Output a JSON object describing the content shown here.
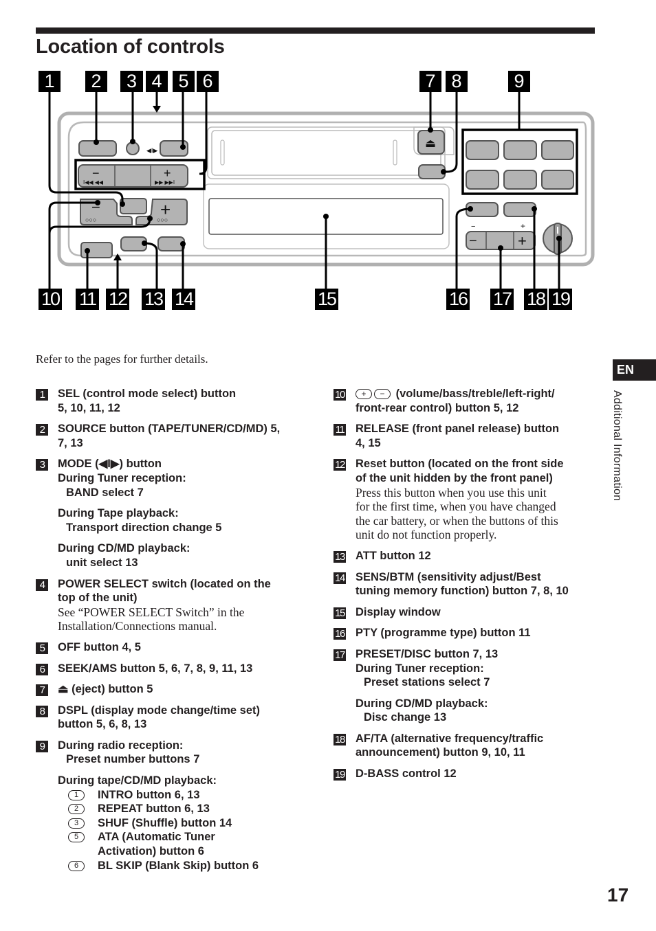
{
  "page": {
    "title": "Location of controls",
    "intro": "Refer to the pages for further details.",
    "section_tab": "EN",
    "side_label": "Additional Information",
    "page_number": "17"
  },
  "diagram": {
    "callouts": [
      "1",
      "2",
      "3",
      "4",
      "5",
      "6",
      "7",
      "8",
      "9",
      "10",
      "11",
      "12",
      "13",
      "14",
      "15",
      "16",
      "17",
      "18",
      "19"
    ],
    "mode_symbol": "◀I▶",
    "minus": "−",
    "plus": "+",
    "seek_back": "I◀◀ ◀◀",
    "seek_fwd": "▶▶ ▶▶I",
    "dots": "○○○",
    "eject": "⏏"
  },
  "left_items": [
    {
      "n": "1",
      "title": "SEL (control mode select) button",
      "line2": "5, 10, 11, 12"
    },
    {
      "n": "2",
      "title": "SOURCE button (TAPE/TUNER/CD/MD) 5,",
      "line2": "7, 13"
    },
    {
      "n": "3",
      "title": "MODE (◀I▶) button",
      "groups": [
        {
          "head": "During Tuner reception:",
          "detail": "BAND select 7"
        },
        {
          "head": "During Tape playback:",
          "detail": "Transport direction change 5"
        },
        {
          "head": "During CD/MD playback:",
          "detail": "unit select 13"
        }
      ]
    },
    {
      "n": "4",
      "title": "POWER SELECT switch (located on the",
      "line2": "top of the unit)",
      "note1": "See “POWER SELECT Switch” in the",
      "note2": "Installation/Connections manual."
    },
    {
      "n": "5",
      "title": "OFF button 4, 5"
    },
    {
      "n": "6",
      "title": "SEEK/AMS button 5, 6, 7, 8, 9, 11, 13"
    },
    {
      "n": "7",
      "title": "⏏ (eject) button 5"
    },
    {
      "n": "8",
      "title": "DSPL (display mode change/time set)",
      "line2": "button 5, 6, 8, 13"
    },
    {
      "n": "9",
      "title": "During radio reception:",
      "detail": "Preset number buttons 7",
      "head2": "During tape/CD/MD playback:",
      "subs": [
        {
          "c": "1",
          "text": "INTRO button 6, 13"
        },
        {
          "c": "2",
          "text": "REPEAT button 6, 13"
        },
        {
          "c": "3",
          "text": "SHUF (Shuffle) button 14"
        },
        {
          "c": "5",
          "text": "ATA (Automatic Tuner",
          "text2": "Activation) button 6"
        },
        {
          "c": "6",
          "text": "BL SKIP (Blank Skip) button 6"
        }
      ]
    }
  ],
  "right_items": [
    {
      "n": "10",
      "plus": "+",
      "minus": "−",
      "title": "(volume/bass/treble/left-right/",
      "line2": "front-rear control) button 5, 12"
    },
    {
      "n": "11",
      "title": "RELEASE (front panel release) button",
      "line2": "4, 15"
    },
    {
      "n": "12",
      "title": "Reset button (located on the front side",
      "line2": "of the unit hidden by the front panel)",
      "note": [
        "Press this button when you use this unit",
        "for the first time, when you have changed",
        "the car battery, or when the buttons of this",
        "unit do not function properly."
      ]
    },
    {
      "n": "13",
      "title": "ATT button 12"
    },
    {
      "n": "14",
      "title": "SENS/BTM (sensitivity adjust/Best",
      "line2": "tuning memory function) button 7, 8, 10"
    },
    {
      "n": "15",
      "title": "Display window"
    },
    {
      "n": "16",
      "title": "PTY (programme type) button 11"
    },
    {
      "n": "17",
      "title": "PRESET/DISC button 7, 13",
      "groups": [
        {
          "head": "During Tuner reception:",
          "detail": "Preset stations select 7"
        },
        {
          "head": "During CD/MD playback:",
          "detail": "Disc change 13"
        }
      ]
    },
    {
      "n": "18",
      "title": "AF/TA (alternative frequency/traffic",
      "line2": "announcement) button 9, 10, 11"
    },
    {
      "n": "19",
      "title": "D-BASS control 12"
    }
  ]
}
